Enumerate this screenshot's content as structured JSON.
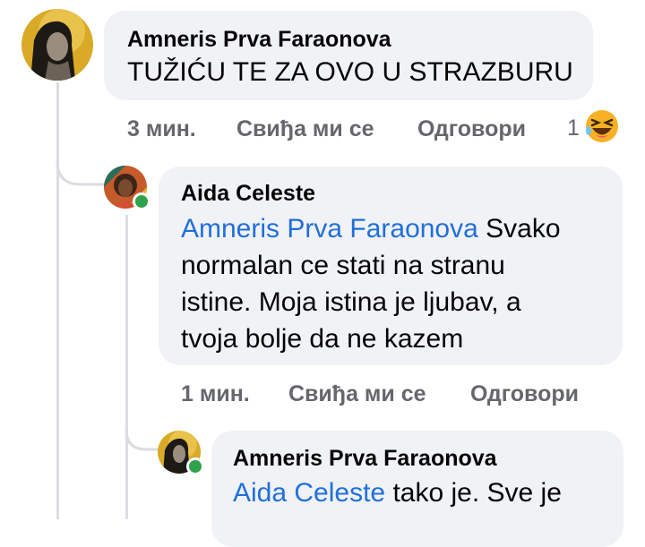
{
  "comments": [
    {
      "author": "Amneris Prva Faraonova",
      "text": "TUŽIĆU TE ZA OVO U STRAZBURU",
      "time": "3 мин.",
      "like_label": "Свиђа ми се",
      "reply_label": "Одговори",
      "reaction_count": "1",
      "reaction_icon": "laughing-emoji-icon"
    },
    {
      "author": "Aida Celeste",
      "mention": "Amneris Prva Faraonova",
      "lines": [
        " Svako",
        "normalan ce stati na stranu",
        "istine. Moja istina je ljubav, a",
        "tvoja bolje da ne kazem"
      ],
      "time": "1 мин.",
      "like_label": "Свиђа ми се",
      "reply_label": "Одговори",
      "online": true
    },
    {
      "author": "Amneris Prva Faraonova",
      "mention": "Aida Celeste",
      "lines": [
        " tako je. Sve je"
      ],
      "online": true
    }
  ],
  "colors": {
    "bubble": "#f0f2f5",
    "mention": "#216fdb",
    "meta": "#65676b",
    "online": "#31a24c"
  }
}
